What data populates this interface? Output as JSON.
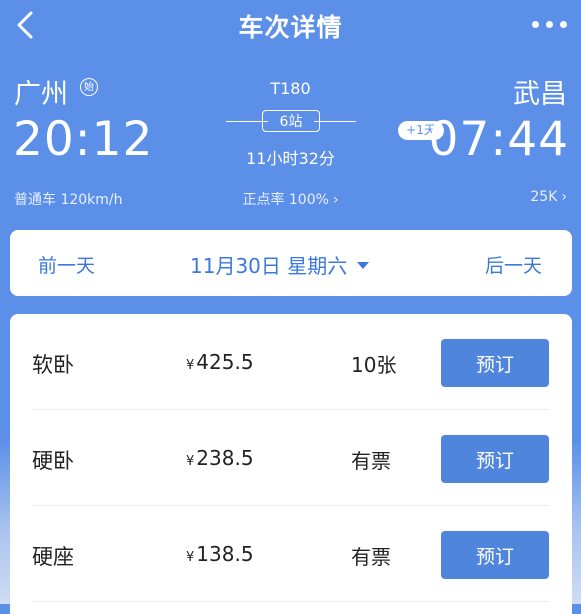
{
  "nav": {
    "title": "车次详情",
    "back_icon": "chevron-left-icon",
    "more_icon": "ellipsis-icon"
  },
  "trip": {
    "from": {
      "station": "广州",
      "start_mark": "始",
      "time": "20:12"
    },
    "to": {
      "station": "武昌",
      "time": "07:44",
      "day_offset": "+1天"
    },
    "train_no": "T180",
    "stops": "6站",
    "duration": "11小时32分",
    "train_type": "普通车 120km/h",
    "punctuality": "正点率 100%",
    "distance": "25K"
  },
  "date_bar": {
    "prev": "前一天",
    "date": "11月30日 星期六",
    "next": "后一天"
  },
  "seats": [
    {
      "name": "软卧",
      "currency": "¥",
      "price": "425.5",
      "availability": "10张",
      "action": "预订"
    },
    {
      "name": "硬卧",
      "currency": "¥",
      "price": "238.5",
      "availability": "有票",
      "action": "预订"
    },
    {
      "name": "硬座",
      "currency": "¥",
      "price": "138.5",
      "availability": "有票",
      "action": "预订"
    }
  ],
  "colors": {
    "header_bg": "#5b8fe8",
    "accent": "#3b78e0",
    "button": "#4f85dc"
  }
}
